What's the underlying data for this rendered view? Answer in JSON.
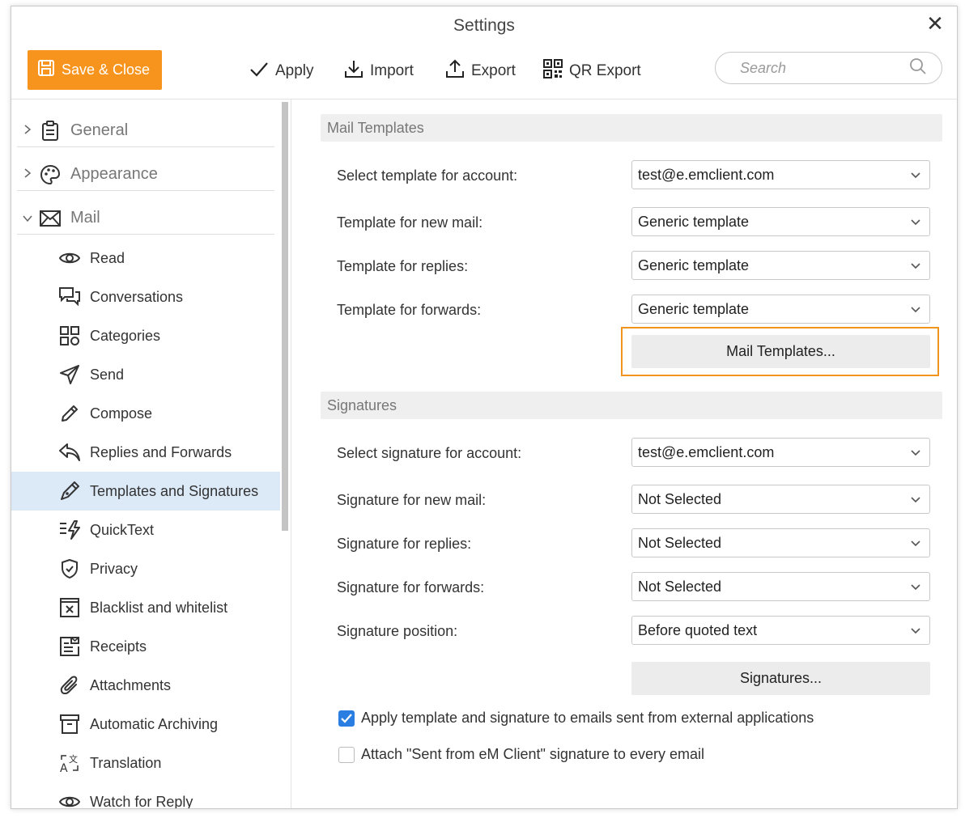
{
  "window": {
    "title": "Settings",
    "close_glyph": "✕"
  },
  "toolbar": {
    "save_close": "Save & Close",
    "apply": "Apply",
    "import": "Import",
    "export": "Export",
    "qr_export": "QR Export",
    "search_placeholder": "Search",
    "accent_color": "#f7941d"
  },
  "sidebar": {
    "groups": [
      {
        "label": "General",
        "icon": "clipboard-icon",
        "expanded": false
      },
      {
        "label": "Appearance",
        "icon": "palette-icon",
        "expanded": false
      },
      {
        "label": "Mail",
        "icon": "envelope-icon",
        "expanded": true
      }
    ],
    "items": [
      {
        "label": "Read",
        "icon": "eye-icon"
      },
      {
        "label": "Conversations",
        "icon": "chat-bubbles-icon"
      },
      {
        "label": "Categories",
        "icon": "categories-grid-icon"
      },
      {
        "label": "Send",
        "icon": "paper-plane-icon"
      },
      {
        "label": "Compose",
        "icon": "pencil-icon"
      },
      {
        "label": "Replies and Forwards",
        "icon": "reply-icon"
      },
      {
        "label": "Templates and Signatures",
        "icon": "pen-nib-icon",
        "active": true
      },
      {
        "label": "QuickText",
        "icon": "quicktext-icon"
      },
      {
        "label": "Privacy",
        "icon": "shield-check-icon"
      },
      {
        "label": "Blacklist and whitelist",
        "icon": "blacklist-icon"
      },
      {
        "label": "Receipts",
        "icon": "receipt-icon"
      },
      {
        "label": "Attachments",
        "icon": "paperclip-icon"
      },
      {
        "label": "Automatic Archiving",
        "icon": "archive-box-icon"
      },
      {
        "label": "Translation",
        "icon": "translate-icon"
      },
      {
        "label": "Watch for Reply",
        "icon": "eye-icon"
      }
    ],
    "active_color": "#dce9f7"
  },
  "mail_templates": {
    "header": "Mail Templates",
    "rows": [
      {
        "label": "Select template for account:",
        "value": "test@e.emclient.com"
      },
      {
        "label": "Template for new mail:",
        "value": "Generic template"
      },
      {
        "label": "Template for replies:",
        "value": "Generic template"
      },
      {
        "label": "Template for forwards:",
        "value": "Generic template"
      }
    ],
    "button": "Mail Templates...",
    "highlight_color": "#f0941d"
  },
  "signatures": {
    "header": "Signatures",
    "rows": [
      {
        "label": "Select signature for account:",
        "value": "test@e.emclient.com"
      },
      {
        "label": "Signature for new mail:",
        "value": "Not Selected"
      },
      {
        "label": "Signature for replies:",
        "value": "Not Selected"
      },
      {
        "label": "Signature for forwards:",
        "value": "Not Selected"
      },
      {
        "label": "Signature position:",
        "value": "Before quoted text"
      }
    ],
    "button": "Signatures..."
  },
  "options": [
    {
      "label": "Apply template and signature to emails sent from external applications",
      "checked": true
    },
    {
      "label": "Attach \"Sent from eM Client\" signature to every email",
      "checked": false
    }
  ],
  "checkbox_color": "#2a7de1"
}
